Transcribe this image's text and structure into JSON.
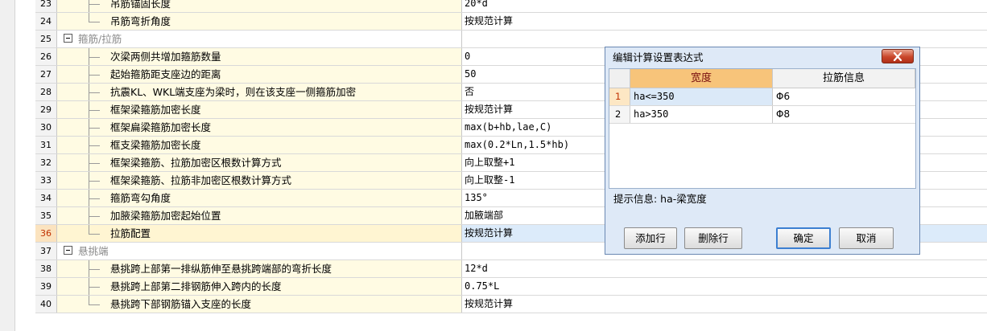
{
  "rows": [
    {
      "no": "23",
      "name": "吊筋锚固长度",
      "value": "20*d"
    },
    {
      "no": "24",
      "name": "吊筋弯折角度",
      "value": "按规范计算"
    },
    {
      "no": "25",
      "group": "箍筋/拉筋"
    },
    {
      "no": "26",
      "name": "次梁两侧共增加箍筋数量",
      "value": "0"
    },
    {
      "no": "27",
      "name": "起始箍筋距支座边的距离",
      "value": "50"
    },
    {
      "no": "28",
      "name": "抗震KL、WKL端支座为梁时，则在该支座一侧箍筋加密",
      "value": "否"
    },
    {
      "no": "29",
      "name": "框架梁箍筋加密长度",
      "value": "按规范计算"
    },
    {
      "no": "30",
      "name": "框架扁梁箍筋加密长度",
      "value": "max(b+hb,lae,C)"
    },
    {
      "no": "31",
      "name": "框支梁箍筋加密长度",
      "value": "max(0.2*Ln,1.5*hb)"
    },
    {
      "no": "32",
      "name": "框架梁箍筋、拉筋加密区根数计算方式",
      "value": "向上取整+1"
    },
    {
      "no": "33",
      "name": "框架梁箍筋、拉筋非加密区根数计算方式",
      "value": "向上取整-1"
    },
    {
      "no": "34",
      "name": "箍筋弯勾角度",
      "value": "135°"
    },
    {
      "no": "35",
      "name": "加腋梁箍筋加密起始位置",
      "value": "加腋端部"
    },
    {
      "no": "36",
      "name": "拉筋配置",
      "value": "按规范计算"
    },
    {
      "no": "37",
      "group": "悬挑端"
    },
    {
      "no": "38",
      "name": "悬挑跨上部第一排纵筋伸至悬挑跨端部的弯折长度",
      "value": "12*d"
    },
    {
      "no": "39",
      "name": "悬挑跨上部第二排钢筋伸入跨内的长度",
      "value": "0.75*L"
    },
    {
      "no": "40",
      "name": "悬挑跨下部钢筋锚入支座的长度",
      "value": "按规范计算"
    }
  ],
  "dialog": {
    "title": "编辑计算设置表达式",
    "columns": [
      "宽度",
      "拉筋信息"
    ],
    "rows": [
      {
        "no": "1",
        "width": "ha<=350",
        "info": "Φ6"
      },
      {
        "no": "2",
        "width": "ha>350",
        "info": "Φ8"
      }
    ],
    "hint": "提示信息: ha-梁宽度",
    "buttons": {
      "add": "添加行",
      "delete": "删除行",
      "ok": "确定",
      "cancel": "取消"
    }
  },
  "colors": {
    "selected_row_number": "#c03000",
    "header_highlight": "#f7c47a",
    "dialog_bg": "#dee9f7",
    "close_button": "#c9462a"
  }
}
